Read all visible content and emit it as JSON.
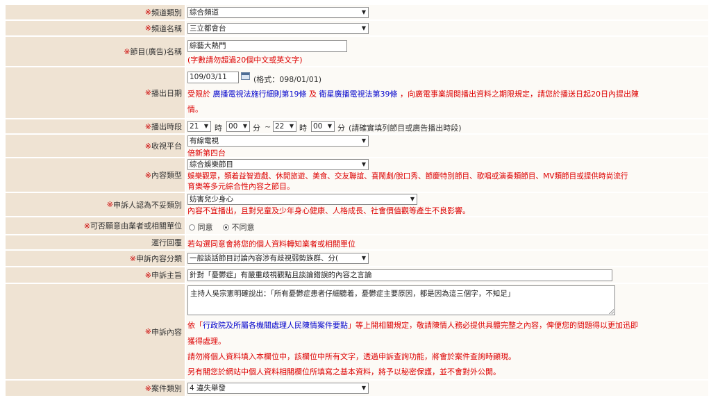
{
  "form": {
    "channel_type": {
      "label_star": "※",
      "label": "頻道類別",
      "value": "綜合頻道"
    },
    "channel_name": {
      "label_star": "※",
      "label": "頻道名稱",
      "value": "三立都會台"
    },
    "program_name": {
      "label_star": "※",
      "label": "節目(廣告)名稱",
      "value": "綜藝大熱門",
      "hint": "(字數請勿超過20個中文或英文字)"
    },
    "air_date": {
      "label_star": "※",
      "label": "播出日期",
      "value": "109/03/11",
      "format_hint": "(格式：098/01/01)",
      "note_pre": "受限於",
      "link1": "廣播電視法施行細則第19條",
      "note_and": "及",
      "link2": "衛星廣播電視法第39條",
      "note_post": "，向廣電事業調閱播出資料之期限規定，請您於播送日起20日內提出陳",
      "note_line2": "情。"
    },
    "air_time": {
      "label_star": "※",
      "label": "播出時段",
      "h1": "21",
      "m1": "00",
      "h2": "22",
      "m2": "00",
      "hour": "時",
      "minute": "分",
      "tilde": "~",
      "hint": "(請確實填列節目或廣告播出時段)"
    },
    "platform": {
      "label_star": "※",
      "label": "收視平台",
      "value": "有線電視",
      "sub": "倍新第四台"
    },
    "content_type": {
      "label_star": "※",
      "label": "內容類型",
      "value": "綜合娛樂節目",
      "desc1": "娛樂觀眾，類着益智遊戲、休閒旅遊、美食、交友聯誼、喜鬧劇/脫口秀、節慶特別節目、歌唱或演奏類節目、MV類節目或提供時尚流行",
      "desc2": "育樂等多元綜合性內容之節目。"
    },
    "complaint_category": {
      "label_star": "※",
      "label": "申訴人認為不妥類別",
      "value": "妨害兒少身心",
      "desc": "內容不宜播出，且對兒童及少年身心健康、人格成長、社會價值觀等產生不良影響。"
    },
    "consent": {
      "label_star": "※",
      "label": "可否願意由業者或相關單位",
      "opt_yes": "同意",
      "opt_no": "不同意"
    },
    "reply": {
      "label": "運行回覆",
      "value": "若勾選同意會將您的個人資料轉知業者或相關單位"
    },
    "subtype": {
      "label_star": "※",
      "label": "申訴內容分類",
      "value": "一般談話節目討論內容涉有歧視弱勢族群、分("
    },
    "subject": {
      "label_star": "※",
      "label": "申訴主旨",
      "value": "針對「憂鬱症」有嚴重歧視觀點且談論錯誤的內容之言論"
    },
    "content": {
      "label_star": "※",
      "label": "申訴內容",
      "text": "主持人吳宗憲明確說出：「所有憂鬱症患者仔細聽着，憂鬱症主要原因，都是因為這三個字，不知足」",
      "note1a": "依「",
      "note1_link": "行政院及所屬各機關處理人民陳情案件要點",
      "note1b": "」等上開相關規定，敬請陳情人務必提供具體完整之內容，俾便您的問題得以更加迅即",
      "note1c": "獲得處理。",
      "note2": "請勿將個人資料填入本欄位中，該欄位中所有文字，透過申訴查詢功能，將會於案件查詢時顯現。",
      "note3": "另有關您於網站中個人資料相關欄位所填寫之基本資料，將予以秘密保護，並不會對外公開。"
    },
    "case_type": {
      "label_star": "※",
      "label": "案件類別",
      "value": "4 違失舉發"
    }
  }
}
